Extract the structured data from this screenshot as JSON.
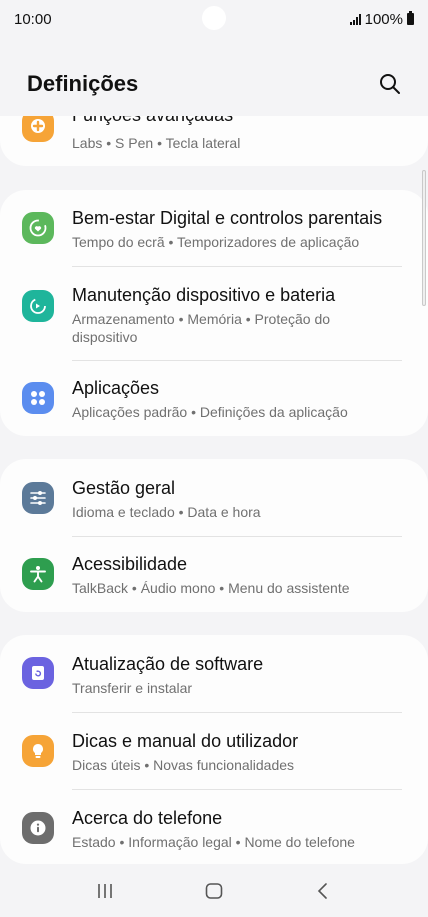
{
  "status_bar": {
    "time": "10:00",
    "battery": "100%"
  },
  "header": {
    "title": "Definições"
  },
  "items": [
    {
      "title": "Funções avançadas",
      "subtitle": "Labs  •  S Pen  •  Tecla lateral",
      "icon": "plus-badge-icon",
      "color": "#f6a437"
    },
    {
      "title": "Bem-estar Digital e controlos parentais",
      "subtitle": "Tempo do ecrã  •  Temporizadores de aplicação",
      "icon": "heart-circle-icon",
      "color": "#5cb85c"
    },
    {
      "title": "Manutenção dispositivo e bateria",
      "subtitle": "Armazenamento  •  Memória  •  Proteção do dispositivo",
      "icon": "refresh-circle-icon",
      "color": "#1fb59b"
    },
    {
      "title": "Aplicações",
      "subtitle": "Aplicações padrão  •  Definições da aplicação",
      "icon": "apps-grid-icon",
      "color": "#5b8def"
    },
    {
      "title": "Gestão geral",
      "subtitle": "Idioma e teclado  •  Data e hora",
      "icon": "sliders-icon",
      "color": "#5c7a99"
    },
    {
      "title": "Acessibilidade",
      "subtitle": "TalkBack  •  Áudio mono  •  Menu do assistente",
      "icon": "person-icon",
      "color": "#2e9e4f"
    },
    {
      "title": "Atualização de software",
      "subtitle": "Transferir e instalar",
      "icon": "update-icon",
      "color": "#6b63e0"
    },
    {
      "title": "Dicas e manual do utilizador",
      "subtitle": "Dicas úteis  •  Novas funcionalidades",
      "icon": "bulb-icon",
      "color": "#f6a437"
    },
    {
      "title": "Acerca do telefone",
      "subtitle": "Estado  •  Informação legal  •  Nome do telefone",
      "icon": "info-icon",
      "color": "#6d6d6d"
    }
  ],
  "nav": {
    "recents": "recents-icon",
    "home": "home-icon",
    "back": "back-icon"
  }
}
